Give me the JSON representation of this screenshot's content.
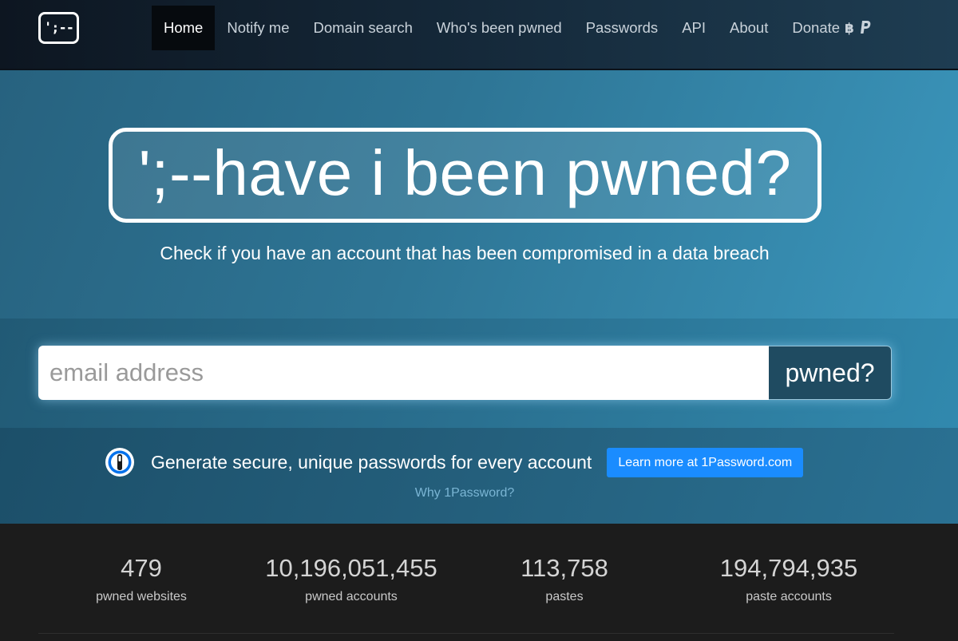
{
  "navbar": {
    "brand_text": "';--",
    "items": [
      {
        "label": "Home",
        "active": true
      },
      {
        "label": "Notify me"
      },
      {
        "label": "Domain search"
      },
      {
        "label": "Who's been pwned"
      },
      {
        "label": "Passwords"
      },
      {
        "label": "API"
      },
      {
        "label": "About"
      },
      {
        "label": "Donate",
        "icons": [
          "bitcoin-icon",
          "paypal-icon"
        ]
      }
    ]
  },
  "hero": {
    "title": "';--have i been pwned?",
    "subtitle": "Check if you have an account that has been compromised in a data breach"
  },
  "search": {
    "placeholder": "email address",
    "value": "",
    "button_label": "pwned?"
  },
  "promo": {
    "icon": "1password-icon",
    "text": "Generate secure, unique passwords for every account",
    "button_label": "Learn more at 1Password.com",
    "link_label": "Why 1Password?"
  },
  "stats": [
    {
      "value": "479",
      "label": "pwned websites"
    },
    {
      "value": "10,196,051,455",
      "label": "pwned accounts"
    },
    {
      "value": "113,758",
      "label": "pastes"
    },
    {
      "value": "194,794,935",
      "label": "paste accounts"
    }
  ],
  "colors": {
    "accent": "#1a8cff",
    "hero_blue": "#2e7595",
    "search_button": "#1f4b61",
    "stats_background": "#1c1c1c"
  }
}
